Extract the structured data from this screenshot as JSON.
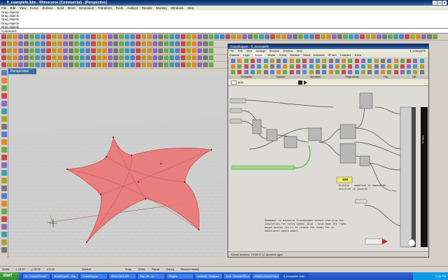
{
  "window": {
    "title": "ll_examplefe.3dm - Rhinoceros (Commercial) - [Perspective]"
  },
  "menu": [
    "File",
    "Edit",
    "View",
    "Curve",
    "Surface",
    "Solid",
    "Mesh",
    "Dimension",
    "Transform",
    "Tools",
    "Analyze",
    "Render",
    "Monkey",
    "Windows",
    "Help"
  ],
  "command": {
    "history": [
      "Drag objects",
      "Drag objects",
      "Drag objects",
      "Drag objects",
      "Drag objects"
    ],
    "prompt": "Command:"
  },
  "viewport": {
    "tab_label": "Perspective"
  },
  "grasshopper": {
    "title": "Grasshopper - ll_examplefe",
    "right_title": "ll_examplefe",
    "menu": [
      "File",
      "Edit",
      "View",
      "Arrange",
      "Solution",
      "Window",
      "Help"
    ],
    "tabs": [
      "Params",
      "Logic",
      "Scalar",
      "Vector",
      "Curve",
      "Surface",
      "Mesh",
      "Intersect",
      "XForm",
      "Complex",
      "Extra"
    ],
    "categories": [
      "Constants",
      "Domain",
      "Operators",
      "Polynomials",
      "Trig",
      "Util"
    ],
    "zoom": "80%",
    "gravity_value": "-100",
    "gravity_note": "Gravity - negative is downwards, positive is upwards !",
    "note": "Remember to minimize Grasshopper before starting the simulation for extra speed. Also - hold down the right mouse button (so it to rotate the view) for an additional speed boost.",
    "status": "Solver session: 19:30:37 (0 seconds ago)",
    "panel_label": "Springies"
  },
  "statusbar": {
    "cplane": "World",
    "x": "x 15.00",
    "y": "y 15.00",
    "z": "z 0.00",
    "layer": "Default",
    "items": [
      "Snap",
      "Ortho",
      "Planar",
      "Osnap",
      "Record History"
    ]
  },
  "taskbar": {
    "start": "start",
    "tasks": [
      "ID - SourceTreeM",
      "SmartCopier - Gra",
      "Grasshopper",
      "Revit 2013 API",
      "Sky_DR_16",
      "Plugins",
      "Untitled - Notepad",
      "Ellie - SketchUPcus",
      "RhinCommon/Physi",
      "ll_examplefe.3dm"
    ],
    "clock": "7:26 PM"
  },
  "colors": {
    "accent": "#3a6ea5",
    "tent": "#e86464",
    "gravity_bg": "#f5ef6a",
    "wire_active": "#4caf3a"
  }
}
